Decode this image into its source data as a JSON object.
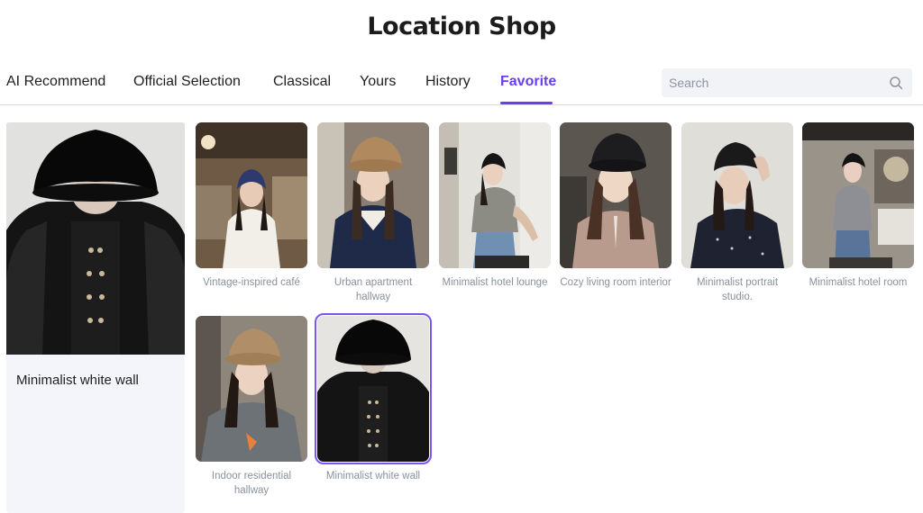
{
  "header": {
    "title": "Location Shop"
  },
  "tabs": [
    {
      "label": "AI Recommend"
    },
    {
      "label": "Official Selection"
    },
    {
      "label": "Classical"
    },
    {
      "label": "Yours"
    },
    {
      "label": "History"
    },
    {
      "label": "Favorite",
      "active": true
    }
  ],
  "search": {
    "placeholder": "Search",
    "icon": "search-icon"
  },
  "featured": {
    "title": "Minimalist white wall"
  },
  "cards": [
    {
      "caption": "Vintage-inspired café"
    },
    {
      "caption": "Urban apartment hallway"
    },
    {
      "caption": "Minimalist hotel lounge"
    },
    {
      "caption": "Cozy living room interior"
    },
    {
      "caption": "Minimalist portrait studio."
    },
    {
      "caption": "Minimalist hotel room"
    },
    {
      "caption": "Indoor residential hallway"
    },
    {
      "caption": "Minimalist white wall",
      "selected": true
    }
  ],
  "colors": {
    "accent": "#6a3df0",
    "caption": "#8a909c",
    "featured_bg": "#f4f5fa"
  }
}
